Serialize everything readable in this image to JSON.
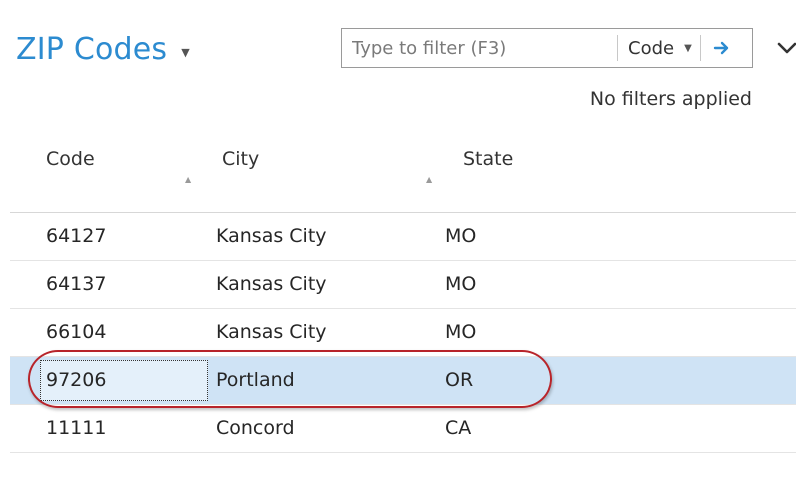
{
  "page": {
    "title": "ZIP Codes"
  },
  "filter": {
    "placeholder": "Type to filter (F3)",
    "field": "Code",
    "status": "No filters applied"
  },
  "table": {
    "columns": [
      {
        "label": "Code"
      },
      {
        "label": "City"
      },
      {
        "label": "State"
      }
    ],
    "rows": [
      {
        "code": "64127",
        "city": "Kansas City",
        "state": "MO"
      },
      {
        "code": "64137",
        "city": "Kansas City",
        "state": "MO"
      },
      {
        "code": "66104",
        "city": "Kansas City",
        "state": "MO"
      },
      {
        "code": "97206",
        "city": "Portland",
        "state": "OR"
      },
      {
        "code": "11111",
        "city": "Concord",
        "state": "CA"
      }
    ],
    "selected_row": 3
  },
  "colors": {
    "accent": "#2c8bd0",
    "selection": "#cfe3f5",
    "annotation": "#b8242a"
  },
  "icons": {
    "title_menu": "caret-down-icon",
    "field_menu": "caret-down-icon",
    "apply": "arrow-right-icon",
    "collapse": "chevron-down-icon",
    "sort": "sort-up-icon"
  }
}
